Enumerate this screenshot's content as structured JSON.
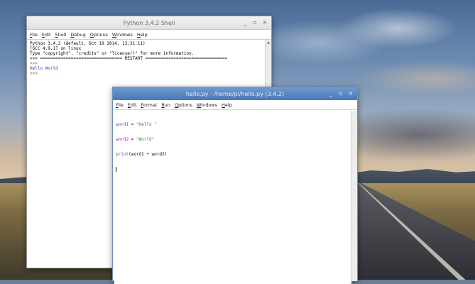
{
  "shell": {
    "title": "Python 3.4.2 Shell",
    "controls": {
      "minimize": "_",
      "maximize": "▫",
      "close": "×"
    },
    "menu": [
      {
        "label": "File",
        "key": "F",
        "rest": "ile"
      },
      {
        "label": "Edit",
        "key": "E",
        "rest": "dit"
      },
      {
        "label": "Shell",
        "key": "S",
        "rest": "hell"
      },
      {
        "label": "Debug",
        "key": "D",
        "rest": "ebug"
      },
      {
        "label": "Options",
        "key": "O",
        "rest": "ptions"
      },
      {
        "label": "Windows",
        "key": "W",
        "rest": "indows"
      },
      {
        "label": "Help",
        "key": "H",
        "rest": "elp"
      }
    ],
    "lines": [
      {
        "text": "Python 3.4.2 (default, Oct 19 2014, 13:31:11)",
        "style": ""
      },
      {
        "text": "[GCC 4.9.1] on linux",
        "style": ""
      },
      {
        "text": "Type \"copyright\", \"credits\" or \"license()\" for more information.",
        "style": ""
      },
      {
        "text": ">>> ================================ RESTART ================================",
        "style": ""
      },
      {
        "text": ">>>",
        "style": "c-red"
      },
      {
        "text": "Hello World",
        "style": "c-blue"
      },
      {
        "text": ">>>",
        "style": "c-red"
      }
    ]
  },
  "editor": {
    "title": "hello.py - /home/pi/hello.py (3.4.2)",
    "controls": {
      "minimize": "_",
      "maximize": "▫",
      "close": "×"
    },
    "menu": [
      {
        "label": "File",
        "key": "F",
        "rest": "ile"
      },
      {
        "label": "Edit",
        "key": "E",
        "rest": "dit"
      },
      {
        "label": "Format",
        "key": "F",
        "rest": "ormat"
      },
      {
        "label": "Run",
        "key": "R",
        "rest": "un"
      },
      {
        "label": "Options",
        "key": "O",
        "rest": "ptions"
      },
      {
        "label": "Windows",
        "key": "W",
        "rest": "indows"
      },
      {
        "label": "Help",
        "key": "H",
        "rest": "elp"
      }
    ],
    "code": [
      {
        "var": "word1",
        "op": " = ",
        "str": "\"Hello \""
      },
      {
        "var": "word2",
        "op": " = ",
        "str": "\"World\""
      }
    ],
    "print_line": {
      "func": "print",
      "args": "(word1 + word2)"
    }
  }
}
